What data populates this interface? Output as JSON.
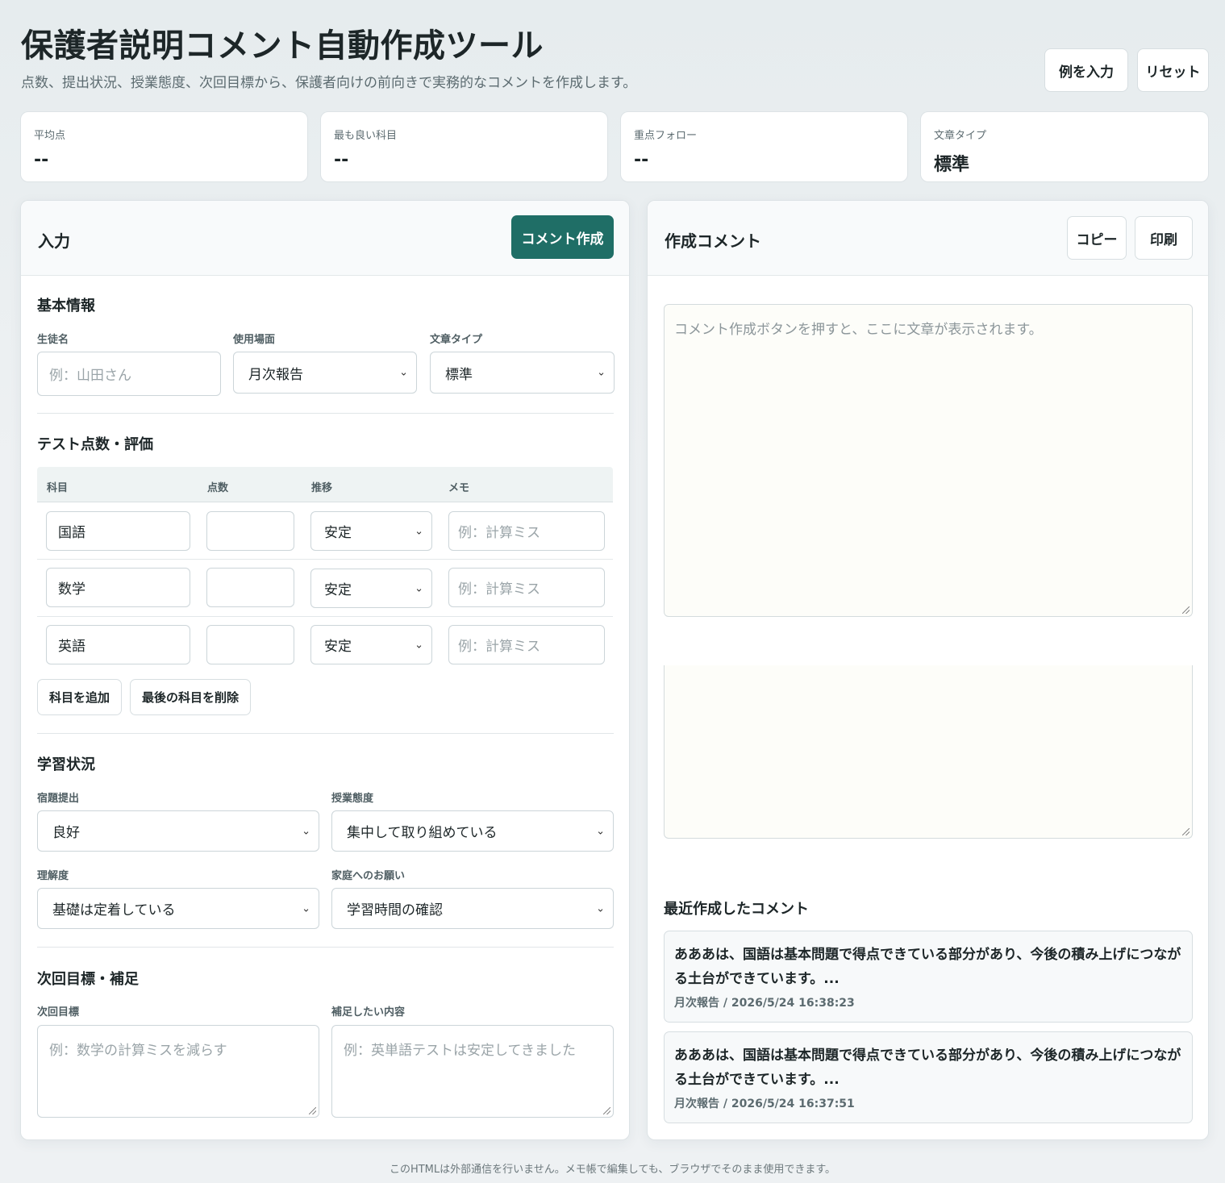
{
  "header": {
    "title": "保護者説明コメント自動作成ツール",
    "subtitle": "点数、提出状況、授業態度、次回目標から、保護者向けの前向きで実務的なコメントを作成します。",
    "example_button": "例を入力",
    "reset_button": "リセット"
  },
  "stats": [
    {
      "label": "平均点",
      "value": "--"
    },
    {
      "label": "最も良い科目",
      "value": "--"
    },
    {
      "label": "重点フォロー",
      "value": "--"
    },
    {
      "label": "文章タイプ",
      "value": "標準"
    }
  ],
  "input_panel": {
    "title": "入力",
    "generate_button": "コメント作成",
    "basic": {
      "title": "基本情報",
      "student_label": "生徒名",
      "student_placeholder": "例：山田さん",
      "scene_label": "使用場面",
      "scene_value": "月次報告",
      "type_label": "文章タイプ",
      "type_value": "標準"
    },
    "scores": {
      "title": "テスト点数・評価",
      "headers": {
        "subject": "科目",
        "score": "点数",
        "trend": "推移",
        "memo": "メモ"
      },
      "rows": [
        {
          "subject": "国語",
          "score": "",
          "trend": "安定",
          "memo_placeholder": "例：計算ミス"
        },
        {
          "subject": "数学",
          "score": "",
          "trend": "安定",
          "memo_placeholder": "例：計算ミス"
        },
        {
          "subject": "英語",
          "score": "",
          "trend": "安定",
          "memo_placeholder": "例：計算ミス"
        }
      ],
      "add_button": "科目を追加",
      "remove_button": "最後の科目を削除"
    },
    "study": {
      "title": "学習状況",
      "homework_label": "宿題提出",
      "homework_value": "良好",
      "attitude_label": "授業態度",
      "attitude_value": "集中して取り組めている",
      "understanding_label": "理解度",
      "understanding_value": "基礎は定着している",
      "request_label": "家庭へのお願い",
      "request_value": "学習時間の確認"
    },
    "goal": {
      "title": "次回目標・補足",
      "goal_label": "次回目標",
      "goal_placeholder": "例：数学の計算ミスを減らす",
      "extra_label": "補足したい内容",
      "extra_placeholder": "例：英単語テストは安定してきました"
    }
  },
  "output_panel": {
    "title": "作成コメント",
    "copy_button": "コピー",
    "print_button": "印刷",
    "output_placeholder": "コメント作成ボタンを押すと、ここに文章が表示されます。",
    "recent_title": "最近作成したコメント",
    "recent": [
      {
        "text": "あああは、国語は基本問題で得点できている部分があり、今後の積み上げにつながる土台ができています。...",
        "meta": "月次報告 / 2026/5/24 16:38:23"
      },
      {
        "text": "あああは、国語は基本問題で得点できている部分があり、今後の積み上げにつながる土台ができています。...",
        "meta": "月次報告 / 2026/5/24 16:37:51"
      }
    ]
  },
  "footer": "このHTMLは外部通信を行いません。メモ帳で編集しても、ブラウザでそのまま使用できます。"
}
